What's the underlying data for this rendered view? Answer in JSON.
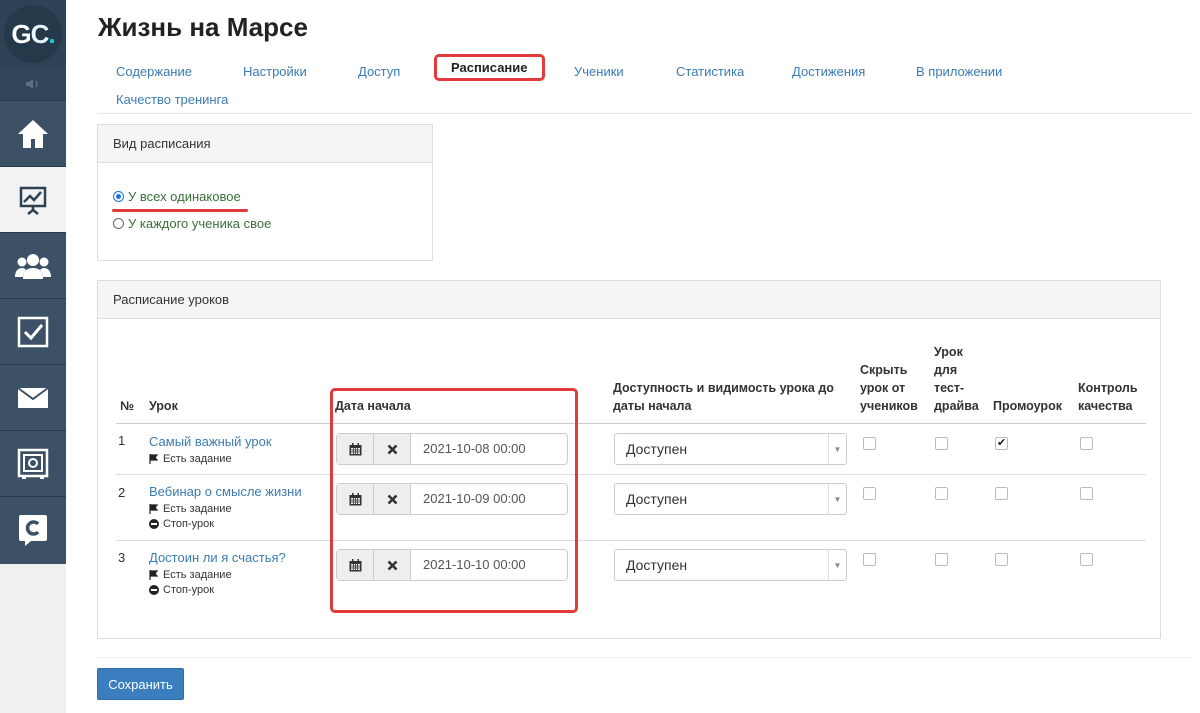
{
  "app": {
    "logo_text": "GC.",
    "title": "Жизнь на Марсе"
  },
  "sidebar": {
    "items": [
      {
        "icon": "home-icon"
      },
      {
        "icon": "chart-icon"
      },
      {
        "icon": "users-icon"
      },
      {
        "icon": "tasks-icon"
      },
      {
        "icon": "mail-icon"
      },
      {
        "icon": "safe-icon"
      },
      {
        "icon": "chat-icon"
      }
    ]
  },
  "tabs": [
    {
      "label": "Содержание"
    },
    {
      "label": "Настройки"
    },
    {
      "label": "Доступ"
    },
    {
      "label": "Расписание",
      "active": true
    },
    {
      "label": "Ученики"
    },
    {
      "label": "Статистика"
    },
    {
      "label": "Достижения"
    },
    {
      "label": "В приложении"
    },
    {
      "label": "Качество тренинга"
    }
  ],
  "schedule_type": {
    "heading": "Вид расписания",
    "options": [
      {
        "label": "У всех одинаковое",
        "checked": true
      },
      {
        "label": "У каждого ученика свое",
        "checked": false
      }
    ]
  },
  "lessons_schedule": {
    "heading": "Расписание уроков",
    "columns": {
      "num": "№",
      "lesson": "Урок",
      "start_date": "Дата начала",
      "availability": "Доступность и видимость урока до даты начала",
      "hide": "Скрыть урок от учеников",
      "testdrive": "Урок для тест-драйва",
      "promo": "Промоурок",
      "quality": "Контроль качества"
    },
    "rows": [
      {
        "num": "1",
        "lesson": "Самый важный урок",
        "meta": [
          "Есть задание"
        ],
        "date": "2021-10-08 00:00",
        "availability": "Доступен",
        "hide": false,
        "testdrive": false,
        "promo": true,
        "quality": false
      },
      {
        "num": "2",
        "lesson": "Вебинар о смысле жизни",
        "meta": [
          "Есть задание",
          "Стоп-урок"
        ],
        "date": "2021-10-09 00:00",
        "availability": "Доступен",
        "hide": false,
        "testdrive": false,
        "promo": false,
        "quality": false
      },
      {
        "num": "3",
        "lesson": "Достоин ли я счастья?",
        "meta": [
          "Есть задание",
          "Стоп-урок"
        ],
        "date": "2021-10-10 00:00",
        "availability": "Доступен",
        "hide": false,
        "testdrive": false,
        "promo": false,
        "quality": false
      }
    ]
  },
  "save_label": "Сохранить",
  "colors": {
    "sidebar": "#3d5166",
    "link": "#3b7bb3",
    "highlight": "#e33b3b",
    "primary_button": "#3a7ec0"
  }
}
